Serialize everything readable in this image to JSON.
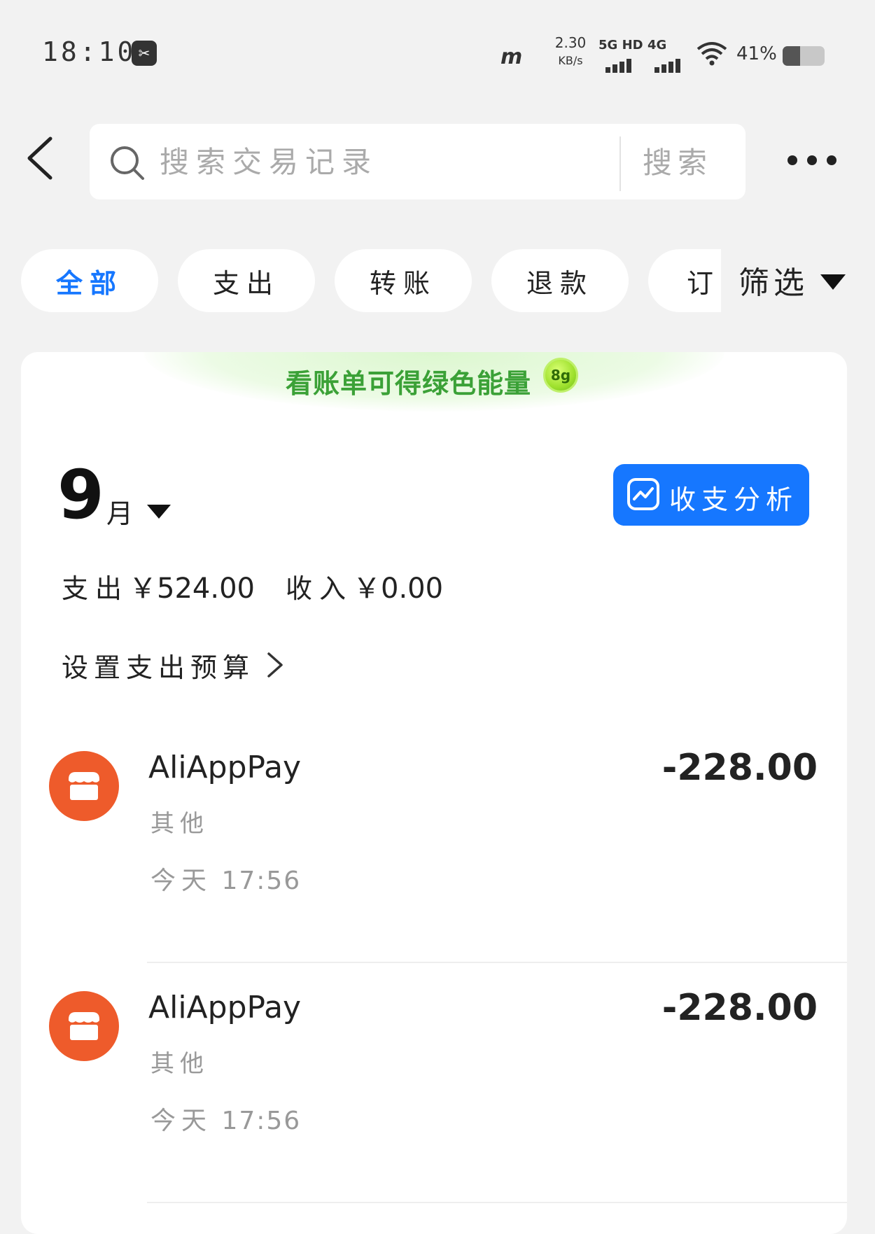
{
  "status_bar": {
    "time": "18:10",
    "carrier_logo": "m",
    "net_speed": "2.30",
    "net_speed_unit": "KB/s",
    "sim1_label": "5G HD",
    "sim2_label": "4G",
    "battery_percent": "41%",
    "battery_level": 0.41
  },
  "header": {
    "search_placeholder": "搜索交易记录",
    "search_button": "搜索"
  },
  "filter_tabs": [
    {
      "label": "全部",
      "active": true
    },
    {
      "label": "支出",
      "active": false
    },
    {
      "label": "转账",
      "active": false
    },
    {
      "label": "退款",
      "active": false
    },
    {
      "label": "订",
      "active": false
    }
  ],
  "filter_button": "筛选",
  "energy_banner": {
    "text": "看账单可得绿色能量",
    "badge": "8g"
  },
  "month": {
    "number": "9",
    "unit": "月"
  },
  "analysis_button": "收支分析",
  "summary": {
    "expense_label": "支出",
    "expense_value": "￥524.00",
    "income_label": "收入",
    "income_value": "￥0.00"
  },
  "budget_link": "设置支出预算",
  "transactions": [
    {
      "merchant": "AliAppPay",
      "amount": "-228.00",
      "category": "其他",
      "date": "今天",
      "time": "17:56"
    },
    {
      "merchant": "AliAppPay",
      "amount": "-228.00",
      "category": "其他",
      "date": "今天",
      "time": "17:56"
    }
  ],
  "colors": {
    "accent": "#1677ff",
    "merchant_avatar": "#ee5b2b",
    "energy_green": "#3ba137",
    "background": "#f2f2f2"
  }
}
